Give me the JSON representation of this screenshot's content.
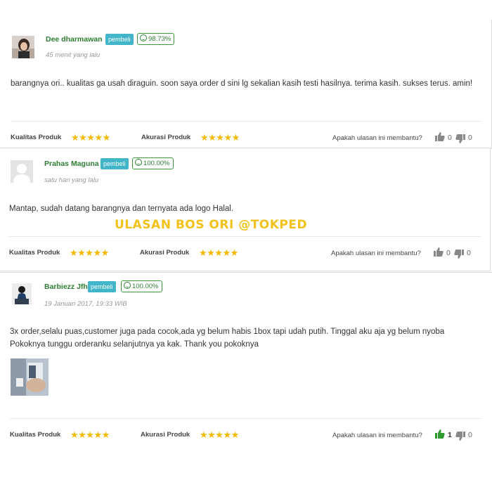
{
  "watermark": "ULASAN BOS ORI @TOKPED",
  "labels": {
    "quality": "Kualitas Produk",
    "accuracy": "Akurasi Produk",
    "helpful": "Apakah ulasan ini membantu?"
  },
  "colors": {
    "name": "#2e7d32",
    "role_badge": "#42b5c9",
    "star": "#f5b800",
    "thumb_active": "#2e9a2e",
    "thumb_idle": "#888888",
    "watermark": "#f2c21a"
  },
  "reviews": [
    {
      "name": "Dee dharmawan",
      "role": "pembeli",
      "score": "98.73%",
      "time": "45 menit yang lalu",
      "text": "barangnya ori.. kualitas ga usah diraguin. soon saya order d sini lg sekalian kasih testi hasilnya. terima kasih. sukses terus. amin!",
      "quality_stars": 5,
      "accuracy_stars": 5,
      "likes": "0",
      "dislikes": "0"
    },
    {
      "name": "Prahas Maguna",
      "role": "pembeli",
      "score": "100.00%",
      "time": "satu hari yang lalu",
      "text": "Mantap, sudah datang barangnya dan ternyata ada logo Halal.",
      "quality_stars": 5,
      "accuracy_stars": 5,
      "likes": "0",
      "dislikes": "0"
    },
    {
      "name": "Barbiezz Jfh",
      "role": "pembeli",
      "score": "100.00%",
      "time": "19 Januari 2017, 19:33 WIB",
      "text": "3x order,selalu puas,customer juga pada cocok,ada yg belum habis 1box tapi udah putih. Tinggal aku aja yg belum nyoba Pokoknya tunggu orderanku selanjutnya ya kak. Thank you pokoknya",
      "quality_stars": 5,
      "accuracy_stars": 5,
      "likes": "1",
      "dislikes": "0"
    }
  ],
  "stars_glyph": "★★★★★"
}
